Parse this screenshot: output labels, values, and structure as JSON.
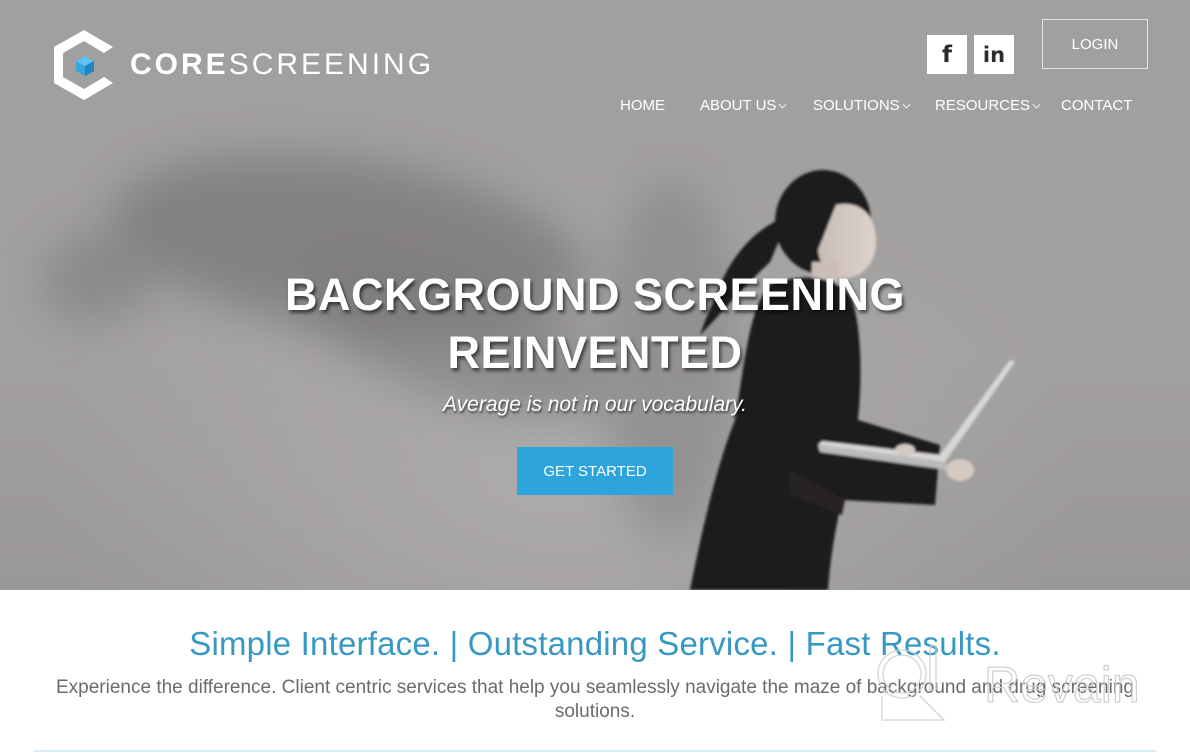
{
  "brand": {
    "name_bold": "CORE",
    "name_light": "SCREENING",
    "accent_color": "#2ea4dc",
    "tagline_color": "#3798c4"
  },
  "header": {
    "social": [
      {
        "name": "facebook",
        "glyph": "f"
      },
      {
        "name": "linkedin",
        "glyph": "in"
      }
    ],
    "login_label": "LOGIN"
  },
  "nav": {
    "items": [
      {
        "label": "HOME",
        "has_dropdown": false
      },
      {
        "label": "ABOUT US",
        "has_dropdown": true
      },
      {
        "label": "SOLUTIONS",
        "has_dropdown": true
      },
      {
        "label": "RESOURCES",
        "has_dropdown": true
      },
      {
        "label": "CONTACT",
        "has_dropdown": false
      }
    ]
  },
  "hero": {
    "title_line1": "BACKGROUND SCREENING",
    "title_line2": "REINVENTED",
    "subtitle": "Average is not in our vocabulary.",
    "cta_label": "GET STARTED"
  },
  "intro": {
    "tagline": "Simple Interface. | Outstanding Service. | Fast Results.",
    "description": "Experience the difference. Client centric services that help you seamlessly navigate the maze of background and drug screening solutions."
  },
  "watermark": {
    "text": "Revain"
  }
}
